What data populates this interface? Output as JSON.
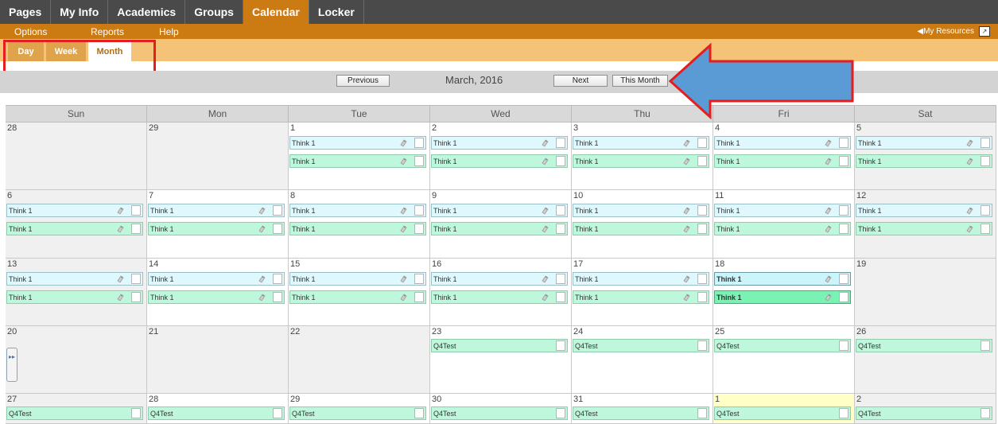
{
  "topnav": {
    "tabs": [
      {
        "label": "Pages"
      },
      {
        "label": "My Info"
      },
      {
        "label": "Academics"
      },
      {
        "label": "Groups"
      },
      {
        "label": "Calendar",
        "active": true
      },
      {
        "label": "Locker"
      }
    ]
  },
  "subnav": {
    "options": "Options",
    "reports": "Reports",
    "help": "Help",
    "resources": "◀My Resources"
  },
  "views": {
    "day": "Day",
    "week": "Week",
    "month": "Month",
    "selected": "Month"
  },
  "monthnav": {
    "previous": "Previous",
    "title": "March, 2016",
    "next": "Next",
    "this_month": "This Month"
  },
  "days_of_week": [
    "Sun",
    "Mon",
    "Tue",
    "Wed",
    "Thu",
    "Fri",
    "Sat"
  ],
  "colors": {
    "accent": "#cc7a12",
    "highlight": "#e41e1e",
    "arrow": "#5b9bd5"
  },
  "weeks": [
    [
      {
        "day": "28",
        "shade": "gray",
        "events": []
      },
      {
        "day": "29",
        "shade": "gray",
        "events": []
      },
      {
        "day": "1",
        "shade": "white",
        "events": [
          {
            "label": "Think 1",
            "kind": "cyan",
            "icon": true
          },
          {
            "label": "Think 1",
            "kind": "green",
            "icon": true
          }
        ]
      },
      {
        "day": "2",
        "shade": "white",
        "events": [
          {
            "label": "Think 1",
            "kind": "cyan",
            "icon": true
          },
          {
            "label": "Think 1",
            "kind": "green",
            "icon": true
          }
        ]
      },
      {
        "day": "3",
        "shade": "white",
        "events": [
          {
            "label": "Think 1",
            "kind": "cyan",
            "icon": true
          },
          {
            "label": "Think 1",
            "kind": "green",
            "icon": true
          }
        ]
      },
      {
        "day": "4",
        "shade": "white",
        "events": [
          {
            "label": "Think 1",
            "kind": "cyan",
            "icon": true
          },
          {
            "label": "Think 1",
            "kind": "green",
            "icon": true
          }
        ]
      },
      {
        "day": "5",
        "shade": "gray",
        "events": [
          {
            "label": "Think 1",
            "kind": "cyan",
            "icon": true
          },
          {
            "label": "Think 1",
            "kind": "green",
            "icon": true
          }
        ]
      }
    ],
    [
      {
        "day": "6",
        "shade": "gray",
        "events": [
          {
            "label": "Think 1",
            "kind": "cyan",
            "icon": true
          },
          {
            "label": "Think 1",
            "kind": "green",
            "icon": true
          }
        ]
      },
      {
        "day": "7",
        "shade": "white",
        "events": [
          {
            "label": "Think 1",
            "kind": "cyan",
            "icon": true
          },
          {
            "label": "Think 1",
            "kind": "green",
            "icon": true
          }
        ]
      },
      {
        "day": "8",
        "shade": "white",
        "events": [
          {
            "label": "Think 1",
            "kind": "cyan",
            "icon": true
          },
          {
            "label": "Think 1",
            "kind": "green",
            "icon": true
          }
        ]
      },
      {
        "day": "9",
        "shade": "white",
        "events": [
          {
            "label": "Think 1",
            "kind": "cyan",
            "icon": true
          },
          {
            "label": "Think 1",
            "kind": "green",
            "icon": true
          }
        ]
      },
      {
        "day": "10",
        "shade": "white",
        "events": [
          {
            "label": "Think 1",
            "kind": "cyan",
            "icon": true
          },
          {
            "label": "Think 1",
            "kind": "green",
            "icon": true
          }
        ]
      },
      {
        "day": "11",
        "shade": "white",
        "events": [
          {
            "label": "Think 1",
            "kind": "cyan",
            "icon": true
          },
          {
            "label": "Think 1",
            "kind": "green",
            "icon": true
          }
        ]
      },
      {
        "day": "12",
        "shade": "gray",
        "events": [
          {
            "label": "Think 1",
            "kind": "cyan",
            "icon": true
          },
          {
            "label": "Think 1",
            "kind": "green",
            "icon": true
          }
        ]
      }
    ],
    [
      {
        "day": "13",
        "shade": "gray",
        "events": [
          {
            "label": "Think 1",
            "kind": "cyan",
            "icon": true
          },
          {
            "label": "Think 1",
            "kind": "green",
            "icon": true
          }
        ]
      },
      {
        "day": "14",
        "shade": "white",
        "events": [
          {
            "label": "Think 1",
            "kind": "cyan",
            "icon": true
          },
          {
            "label": "Think 1",
            "kind": "green",
            "icon": true
          }
        ]
      },
      {
        "day": "15",
        "shade": "white",
        "events": [
          {
            "label": "Think 1",
            "kind": "cyan",
            "icon": true
          },
          {
            "label": "Think 1",
            "kind": "green",
            "icon": true
          }
        ]
      },
      {
        "day": "16",
        "shade": "white",
        "events": [
          {
            "label": "Think 1",
            "kind": "cyan",
            "icon": true
          },
          {
            "label": "Think 1",
            "kind": "green",
            "icon": true
          }
        ]
      },
      {
        "day": "17",
        "shade": "white",
        "events": [
          {
            "label": "Think 1",
            "kind": "cyan",
            "icon": true
          },
          {
            "label": "Think 1",
            "kind": "green",
            "icon": true
          }
        ]
      },
      {
        "day": "18",
        "shade": "white",
        "events": [
          {
            "label": "Think 1",
            "kind": "cyan",
            "icon": true,
            "bold": true
          },
          {
            "label": "Think 1",
            "kind": "green",
            "icon": true,
            "bold": true
          }
        ]
      },
      {
        "day": "19",
        "shade": "gray",
        "events": []
      }
    ],
    [
      {
        "day": "20",
        "shade": "gray",
        "events": []
      },
      {
        "day": "21",
        "shade": "gray",
        "events": []
      },
      {
        "day": "22",
        "shade": "gray",
        "events": []
      },
      {
        "day": "23",
        "shade": "white",
        "events": [
          {
            "label": "Q4Test",
            "kind": "green",
            "icon": false
          }
        ]
      },
      {
        "day": "24",
        "shade": "white",
        "events": [
          {
            "label": "Q4Test",
            "kind": "green",
            "icon": false
          }
        ]
      },
      {
        "day": "25",
        "shade": "white",
        "events": [
          {
            "label": "Q4Test",
            "kind": "green",
            "icon": false
          }
        ]
      },
      {
        "day": "26",
        "shade": "gray",
        "events": [
          {
            "label": "Q4Test",
            "kind": "green",
            "icon": false
          }
        ]
      }
    ],
    [
      {
        "day": "27",
        "shade": "gray",
        "events": [
          {
            "label": "Q4Test",
            "kind": "green",
            "icon": false
          }
        ]
      },
      {
        "day": "28",
        "shade": "white",
        "events": [
          {
            "label": "Q4Test",
            "kind": "green",
            "icon": false
          }
        ]
      },
      {
        "day": "29",
        "shade": "white",
        "events": [
          {
            "label": "Q4Test",
            "kind": "green",
            "icon": false
          }
        ]
      },
      {
        "day": "30",
        "shade": "white",
        "events": [
          {
            "label": "Q4Test",
            "kind": "green",
            "icon": false
          }
        ]
      },
      {
        "day": "31",
        "shade": "white",
        "events": [
          {
            "label": "Q4Test",
            "kind": "green",
            "icon": false
          }
        ]
      },
      {
        "day": "1",
        "shade": "today",
        "events": [
          {
            "label": "Q4Test",
            "kind": "green",
            "icon": false
          }
        ]
      },
      {
        "day": "2",
        "shade": "gray",
        "events": [
          {
            "label": "Q4Test",
            "kind": "green",
            "icon": false
          }
        ]
      }
    ]
  ]
}
